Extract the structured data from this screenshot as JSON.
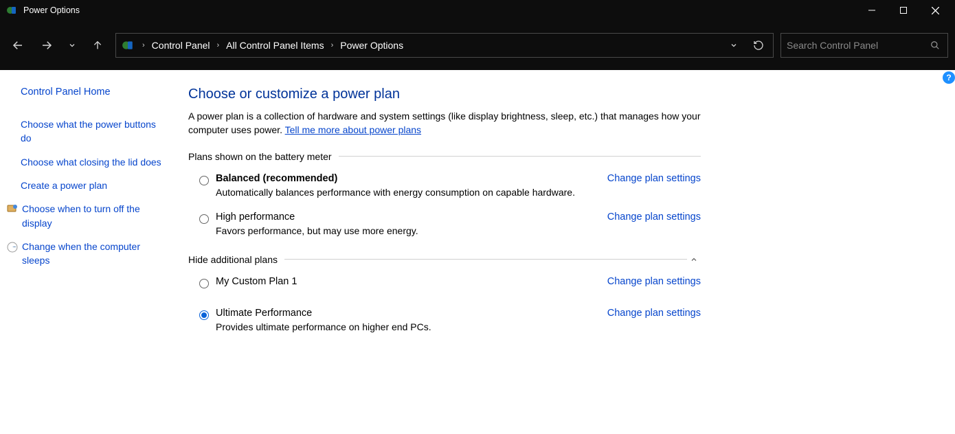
{
  "window": {
    "title": "Power Options"
  },
  "breadcrumbs": {
    "b0": "Control Panel",
    "b1": "All Control Panel Items",
    "b2": "Power Options"
  },
  "search": {
    "placeholder": "Search Control Panel"
  },
  "sidebar": {
    "home": "Control Panel Home",
    "l0": "Choose what the power buttons do",
    "l1": "Choose what closing the lid does",
    "l2": "Create a power plan",
    "l3": "Choose when to turn off the display",
    "l4": "Change when the computer sleeps"
  },
  "main": {
    "heading": "Choose or customize a power plan",
    "desc_prefix": "A power plan is a collection of hardware and system settings (like display brightness, sleep, etc.) that manages how your computer uses power. ",
    "desc_link": "Tell me more about power plans",
    "section1": "Plans shown on the battery meter",
    "section2": "Hide additional plans",
    "change_link": "Change plan settings",
    "plans": {
      "p0": {
        "name": "Balanced (recommended)",
        "desc": "Automatically balances performance with energy consumption on capable hardware."
      },
      "p1": {
        "name": "High performance",
        "desc": "Favors performance, but may use more energy."
      },
      "p2": {
        "name": "My Custom Plan 1",
        "desc": ""
      },
      "p3": {
        "name": "Ultimate Performance",
        "desc": "Provides ultimate performance on higher end PCs."
      }
    }
  },
  "help_icon": "?"
}
